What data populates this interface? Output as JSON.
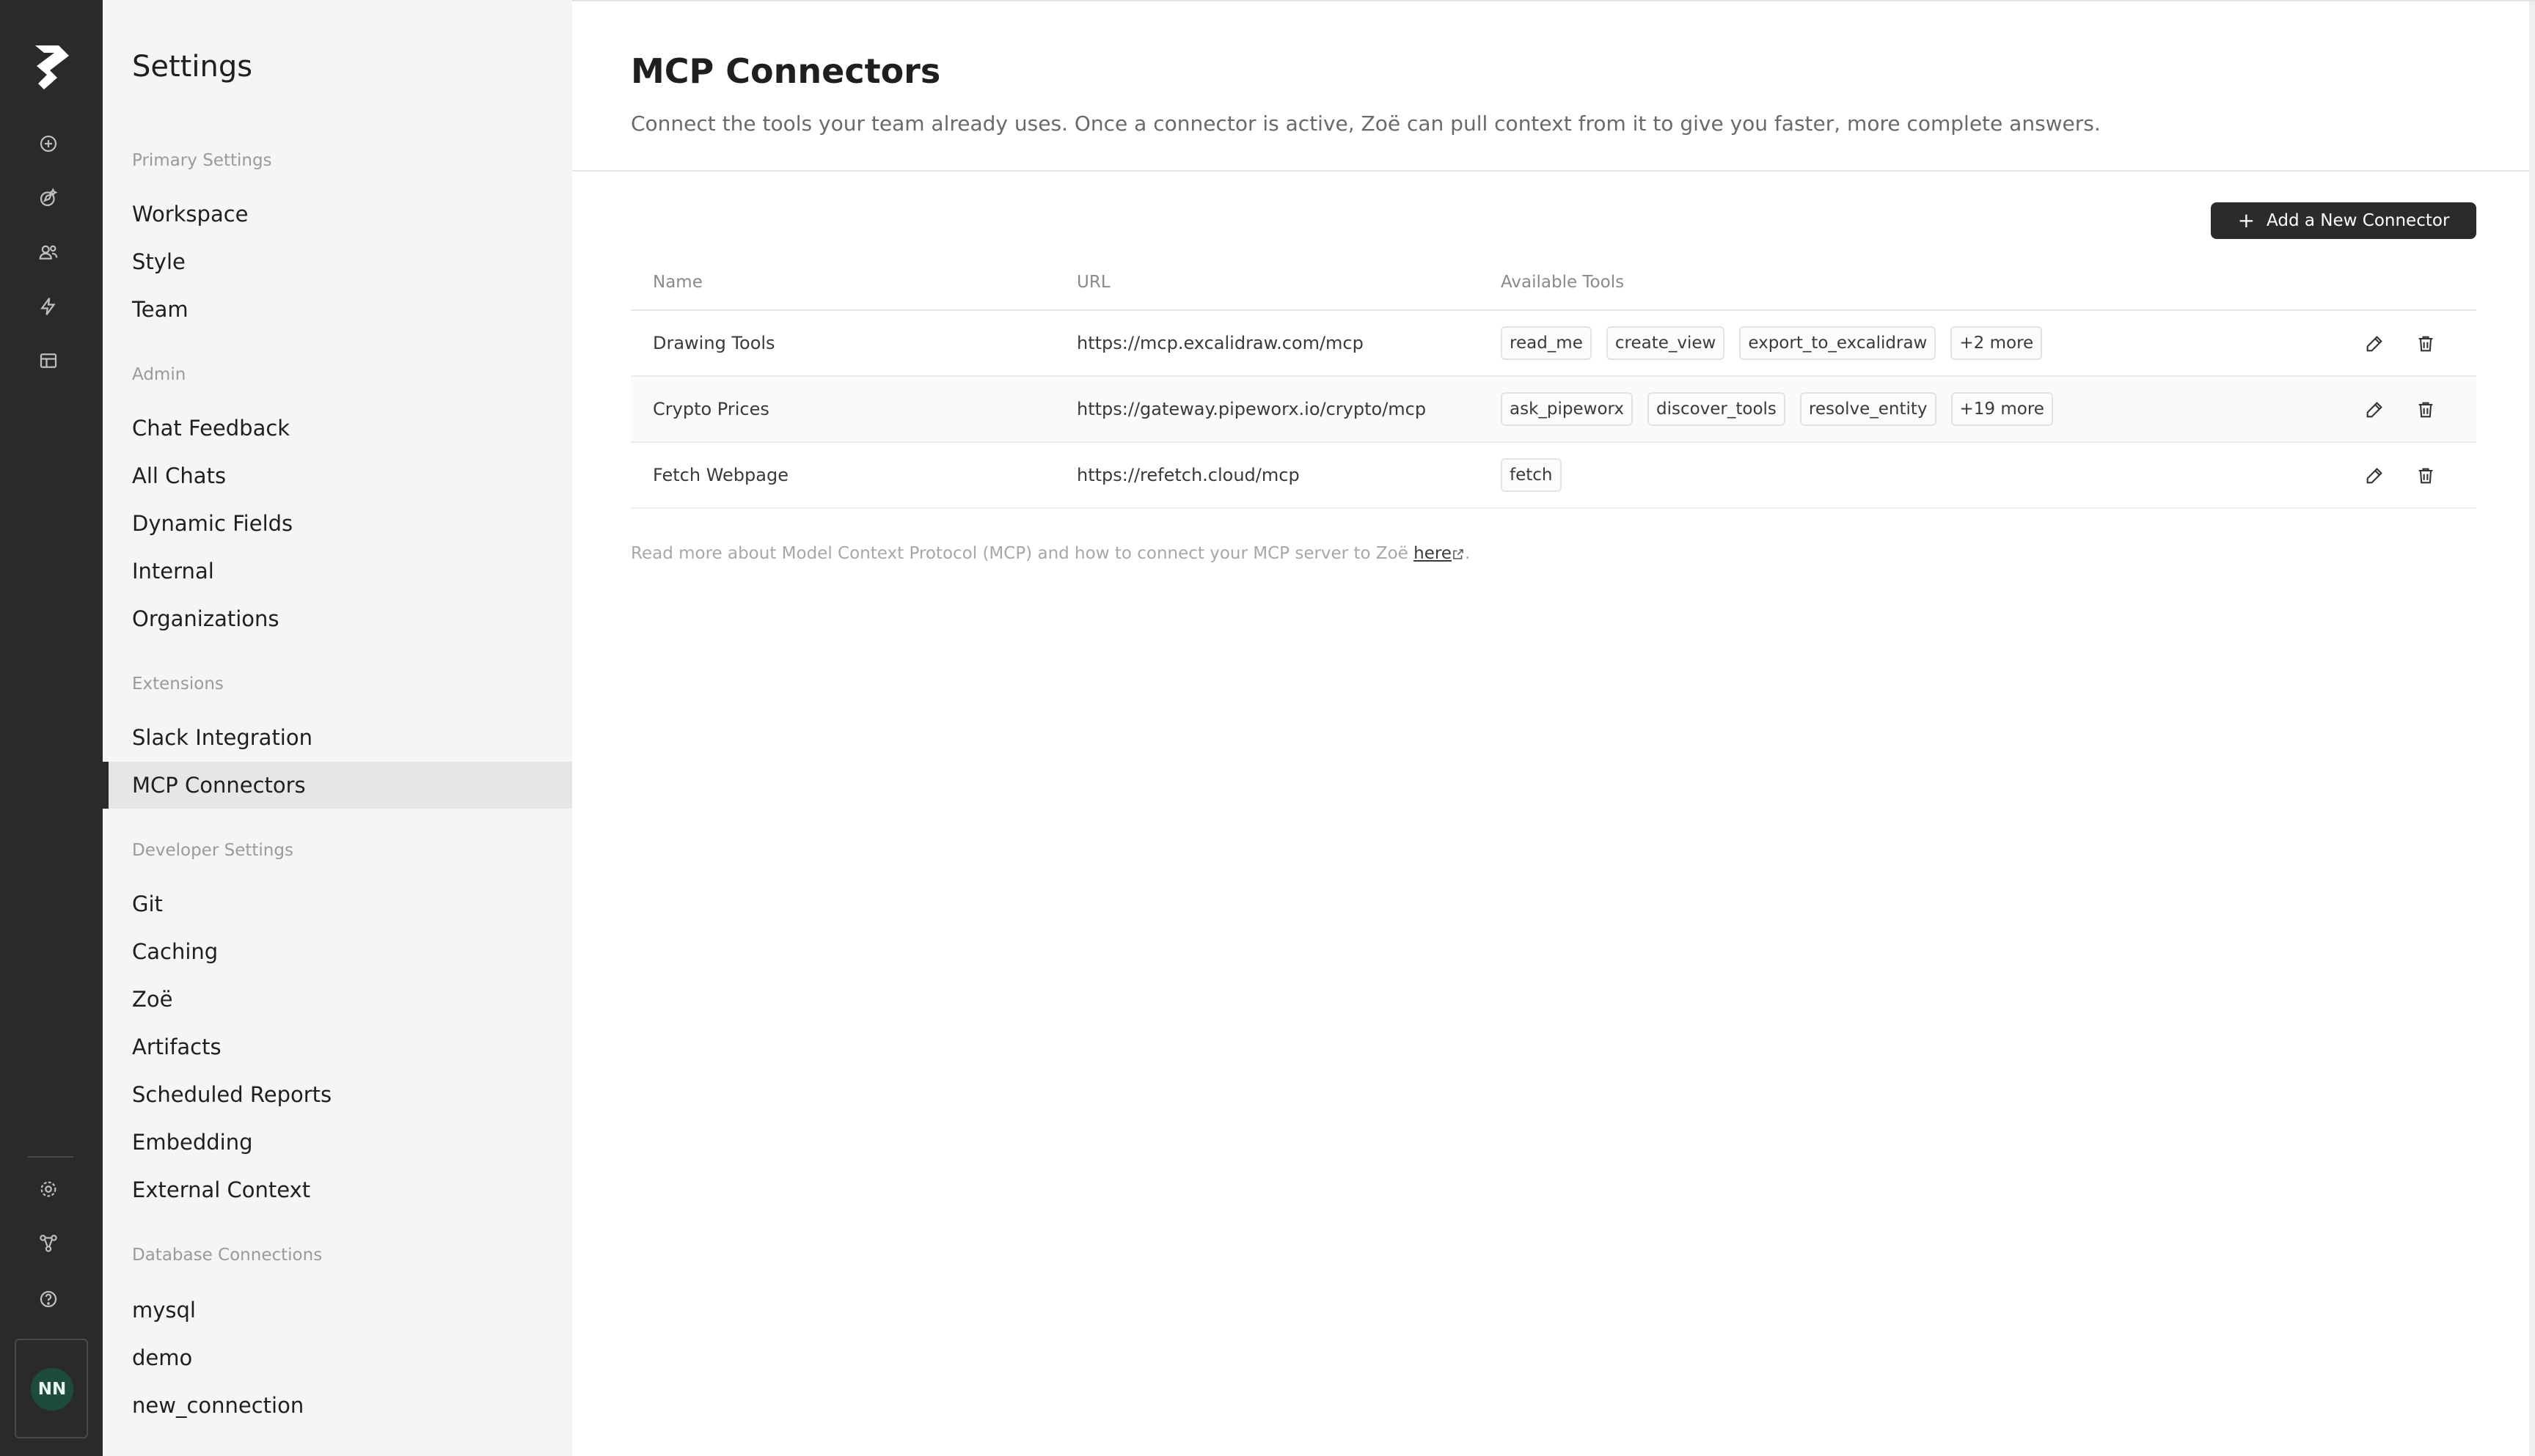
{
  "sidebar": {
    "title": "Settings",
    "sections": [
      {
        "label": "Primary Settings",
        "items": [
          "Workspace",
          "Style",
          "Team"
        ]
      },
      {
        "label": "Admin",
        "items": [
          "Chat Feedback",
          "All Chats",
          "Dynamic Fields",
          "Internal",
          "Organizations"
        ]
      },
      {
        "label": "Extensions",
        "items": [
          "Slack Integration",
          "MCP Connectors"
        ]
      },
      {
        "label": "Developer Settings",
        "items": [
          "Git",
          "Caching",
          "Zoë",
          "Artifacts",
          "Scheduled Reports",
          "Embedding",
          "External Context"
        ]
      },
      {
        "label": "Database Connections",
        "items": [
          "mysql",
          "demo",
          "new_connection"
        ]
      }
    ],
    "active_item": "MCP Connectors"
  },
  "rail": {
    "icons": [
      "new-chat-icon",
      "explore-icon",
      "people-icon",
      "bolt-icon",
      "layout-icon"
    ],
    "bottom_icons": [
      "gear-icon",
      "integrations-icon",
      "help-icon"
    ],
    "user_initials": "NN",
    "avatar_color": "#1d4d3a"
  },
  "main": {
    "title": "MCP Connectors",
    "description": "Connect the tools your team already uses. Once a connector is active, Zoë can pull context from it to give you faster, more complete answers.",
    "add_button_label": "Add a New Connector",
    "columns": {
      "name": "Name",
      "url": "URL",
      "tools": "Available Tools"
    },
    "rows": [
      {
        "name": "Drawing Tools",
        "url": "https://mcp.excalidraw.com/mcp",
        "tools": [
          "read_me",
          "create_view",
          "export_to_excalidraw"
        ],
        "more": "+2 more"
      },
      {
        "name": "Crypto Prices",
        "url": "https://gateway.pipeworx.io/crypto/mcp",
        "tools": [
          "ask_pipeworx",
          "discover_tools",
          "resolve_entity"
        ],
        "more": "+19 more"
      },
      {
        "name": "Fetch Webpage",
        "url": "https://refetch.cloud/mcp",
        "tools": [
          "fetch"
        ],
        "more": ""
      }
    ],
    "footnote_prefix": "Read more about Model Context Protocol (MCP) and how to connect your MCP server to Zoë ",
    "footnote_link": "here",
    "footnote_suffix": "."
  },
  "colors": {
    "rail_bg": "#2a2a2a",
    "sidebar_bg": "#f5f5f5",
    "primary_button": "#2b2b2b"
  }
}
